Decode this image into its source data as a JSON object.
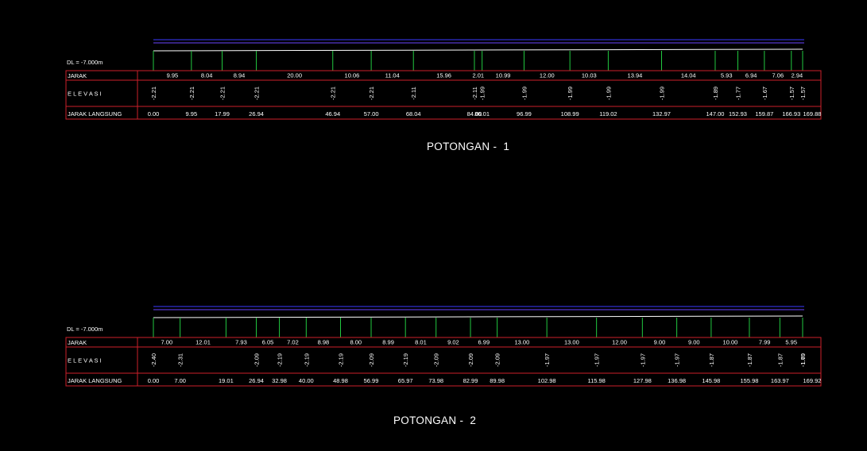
{
  "colors": {
    "background": "#000000",
    "grid": "#cc1f2a",
    "station": "#22c940",
    "ground": "#ffffff",
    "water_top": "#3a3aff",
    "water_bottom": "#6a45ff",
    "text": "#ffffff"
  },
  "sections": [
    {
      "title": "POTONGAN -  1",
      "datum": "DL = -7.000m",
      "row_labels": {
        "jarak": "JARAK",
        "elevasi": "E L E V A S I",
        "langsung": "JARAK LANGSUNG"
      },
      "stations": [
        0.0,
        9.95,
        17.99,
        26.94,
        46.94,
        57.0,
        68.04,
        84.0,
        86.01,
        96.99,
        108.99,
        119.02,
        132.97,
        147.0,
        152.93,
        159.87,
        166.93,
        169.88
      ],
      "jarak_langsung": [
        "0.00",
        "9.95",
        "17.99",
        "26.94",
        "46.94",
        "57.00",
        "68.04",
        "84.00",
        "86.01",
        "96.99",
        "108.99",
        "119.02",
        "132.97",
        "147.00",
        "152.93",
        "159.87",
        "166.93",
        "169.88"
      ],
      "jarak": [
        "9.95",
        "8.04",
        "8.94",
        "20.00",
        "10.06",
        "11.04",
        "15.96",
        "2.01",
        "10.99",
        "12.00",
        "10.03",
        "13.94",
        "14.04",
        "5.93",
        "6.94",
        "7.06",
        "2.94"
      ],
      "elevasi": [
        "-2.21",
        "-2.21",
        "-2.21",
        "-2.21",
        "-2.21",
        "-2.21",
        "-2.11",
        "-2.11",
        "-1.99",
        "-1.99",
        "-1.99",
        "-1.99",
        "-1.99",
        "-1.89",
        "-1.77",
        "-1.67",
        "-1.57",
        "-1.57"
      ],
      "elevasi_stations": [
        0.0,
        9.95,
        17.99,
        26.94,
        46.94,
        57.0,
        68.04,
        84.0,
        86.01,
        96.99,
        108.99,
        119.02,
        132.97,
        147.0,
        152.93,
        159.87,
        166.93,
        169.88
      ]
    },
    {
      "title": "POTONGAN -  2",
      "datum": "DL = -7.000m",
      "row_labels": {
        "jarak": "JARAK",
        "elevasi": "E L E V A S I",
        "langsung": "JARAK LANGSUNG"
      },
      "stations": [
        0.0,
        7.0,
        19.01,
        26.94,
        32.98,
        40.0,
        48.98,
        56.99,
        65.97,
        73.98,
        82.99,
        89.98,
        102.98,
        115.98,
        127.98,
        136.98,
        145.98,
        155.98,
        163.97,
        169.92
      ],
      "jarak_langsung": [
        "0.00",
        "7.00",
        "19.01",
        "26.94",
        "32.98",
        "40.00",
        "48.98",
        "56.99",
        "65.97",
        "73.98",
        "82.99",
        "89.98",
        "102.98",
        "115.98",
        "127.98",
        "136.98",
        "145.98",
        "155.98",
        "163.97",
        "169.92"
      ],
      "jarak": [
        "7.00",
        "12.01",
        "7.93",
        "6.05",
        "7.02",
        "8.98",
        "8.00",
        "8.99",
        "8.01",
        "9.02",
        "6.99",
        "13.00",
        "13.00",
        "12.00",
        "9.00",
        "9.00",
        "10.00",
        "7.99",
        "5.95"
      ],
      "elevasi": [
        "-2.40",
        "-2.31",
        "-2.09",
        "-2.19",
        "-2.19",
        "-2.19",
        "-2.09",
        "-2.19",
        "-2.09",
        "-2.09",
        "-2.09",
        "-1.97",
        "-1.97",
        "-1.97",
        "-1.97",
        "-1.87",
        "-1.87",
        "-1.87",
        "-1.79",
        "-1.69"
      ],
      "elevasi_stations": [
        0.0,
        7.0,
        26.94,
        32.98,
        40.0,
        48.98,
        56.99,
        65.97,
        73.98,
        82.99,
        89.98,
        102.98,
        115.98,
        127.98,
        136.98,
        145.98,
        155.98,
        163.97,
        169.92,
        169.92
      ]
    }
  ]
}
